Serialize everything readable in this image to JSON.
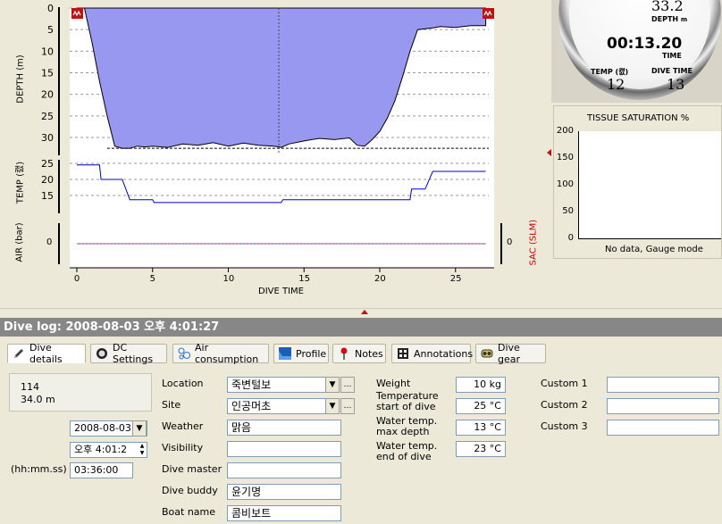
{
  "profile": {
    "depth_axis_label": "DEPTH (m)",
    "temp_axis_label": "TEMP (캜)",
    "air_axis_label": "AIR (bar)",
    "sac_axis_label": "SAC (SLM)",
    "x_axis_label": "DIVE TIME",
    "depth_ticks": [
      "0",
      "5",
      "10",
      "15",
      "20",
      "25",
      "30"
    ],
    "temp_ticks": [
      "25",
      "20",
      "15"
    ],
    "air_tick": "0",
    "sac_tick": "0",
    "x_ticks": [
      "0",
      "5",
      "10",
      "15",
      "20",
      "25"
    ]
  },
  "gauge": {
    "depth_value": "33.2",
    "depth_label": "DEPTH",
    "depth_unit": "m",
    "time_value": "00:13.20",
    "time_label": "TIME",
    "temp_label": "TEMP (캜)",
    "temp_value": "12",
    "dive_time_label": "DIVE TIME",
    "dive_time_value": "13"
  },
  "tissue": {
    "title": "TISSUE SATURATION %",
    "ticks": [
      "200",
      "150",
      "100",
      "50",
      "0"
    ],
    "note": "No data, Gauge mode"
  },
  "divelog": {
    "title": "Dive log: 2008-08-03 오후 4:01:27"
  },
  "tabs": [
    {
      "label": "Dive details",
      "icon": "pencil-icon"
    },
    {
      "label": "DC Settings",
      "icon": "gauge-icon"
    },
    {
      "label": "Air consumption",
      "icon": "bubbles-icon"
    },
    {
      "label": "Profile",
      "icon": "profile-icon"
    },
    {
      "label": "Notes",
      "icon": "pin-icon"
    },
    {
      "label": "Annotations",
      "icon": "film-icon"
    },
    {
      "label": "Dive gear",
      "icon": "mask-icon"
    }
  ],
  "details": {
    "dive_number": "114",
    "max_depth": "34.0 m",
    "date": "2008-08-03",
    "time": "오후  4:01:2",
    "duration_label": "(hh:mm.ss)",
    "duration": "03:36:00",
    "location_label": "Location",
    "location": "죽변털보",
    "site_label": "Site",
    "site": "인공머초",
    "weather_label": "Weather",
    "weather": "맑음",
    "visibility_label": "Visibility",
    "visibility": "",
    "divemaster_label": "Dive master",
    "divemaster": "",
    "divebuddy_label": "Dive buddy",
    "divebuddy": "윤기명",
    "boatname_label": "Boat name",
    "boatname": "콤비보트",
    "weight_label": "Weight",
    "weight": "10 kg",
    "temp_start_label_1": "Temperature",
    "temp_start_label_2": "start of dive",
    "temp_start": "25 °C",
    "temp_max_label_1": "Water temp.",
    "temp_max_label_2": "max depth",
    "temp_max": "13 °C",
    "temp_end_label_1": "Water temp.",
    "temp_end_label_2": "end of dive",
    "temp_end": "23 °C",
    "custom1_label": "Custom 1",
    "custom1": "",
    "custom2_label": "Custom 2",
    "custom2": "",
    "custom3_label": "Custom 3",
    "custom3": ""
  },
  "colors": {
    "depth_fill": "#9898f0",
    "temp_line": "#0000c0",
    "sac_label": "#c00000",
    "header_bg": "#878787"
  },
  "chart_data": {
    "type": "area",
    "xlabel": "DIVE TIME",
    "x_range": [
      0,
      27.2
    ],
    "series": [
      {
        "name": "DEPTH (m)",
        "ylim": [
          0,
          32.5
        ],
        "x": [
          0,
          0.5,
          1,
          1.5,
          2,
          2.5,
          3,
          3.5,
          4,
          4.5,
          5,
          6,
          7,
          8,
          9,
          10,
          11,
          12,
          13,
          13.5,
          14,
          15,
          16,
          17,
          18,
          18.5,
          19,
          19.5,
          20,
          20.5,
          21,
          21.5,
          22,
          22.5,
          23,
          23.5,
          24,
          25,
          26,
          27
        ],
        "values": [
          0,
          0,
          8,
          17,
          25,
          32,
          32.5,
          32.5,
          32,
          32.2,
          32,
          32.3,
          31.5,
          31.8,
          31.2,
          32,
          31.3,
          31.8,
          32,
          32.3,
          31.5,
          30.8,
          30.2,
          30.5,
          30.1,
          31.8,
          32,
          30.5,
          28.6,
          25.5,
          21.5,
          16,
          10,
          5,
          4.8,
          4.6,
          4.3,
          4.5,
          4.1,
          4.1
        ]
      },
      {
        "name": "TEMP (캜)",
        "ylim": [
          10.5,
          26.5
        ],
        "x": [
          0,
          1.5,
          1.6,
          3,
          3.5,
          5,
          5.1,
          13.5,
          13.6,
          15,
          15.1,
          22,
          22.1,
          23,
          23.5,
          25,
          27
        ],
        "values": [
          24.5,
          24.5,
          20,
          20,
          13.7,
          13.7,
          12.8,
          12.8,
          13.7,
          13.7,
          13.7,
          13.7,
          17,
          17,
          22.5,
          22.5,
          22.5
        ]
      },
      {
        "name": "AIR (bar)",
        "x": [
          0,
          27
        ],
        "values": [
          0,
          0
        ]
      }
    ]
  }
}
